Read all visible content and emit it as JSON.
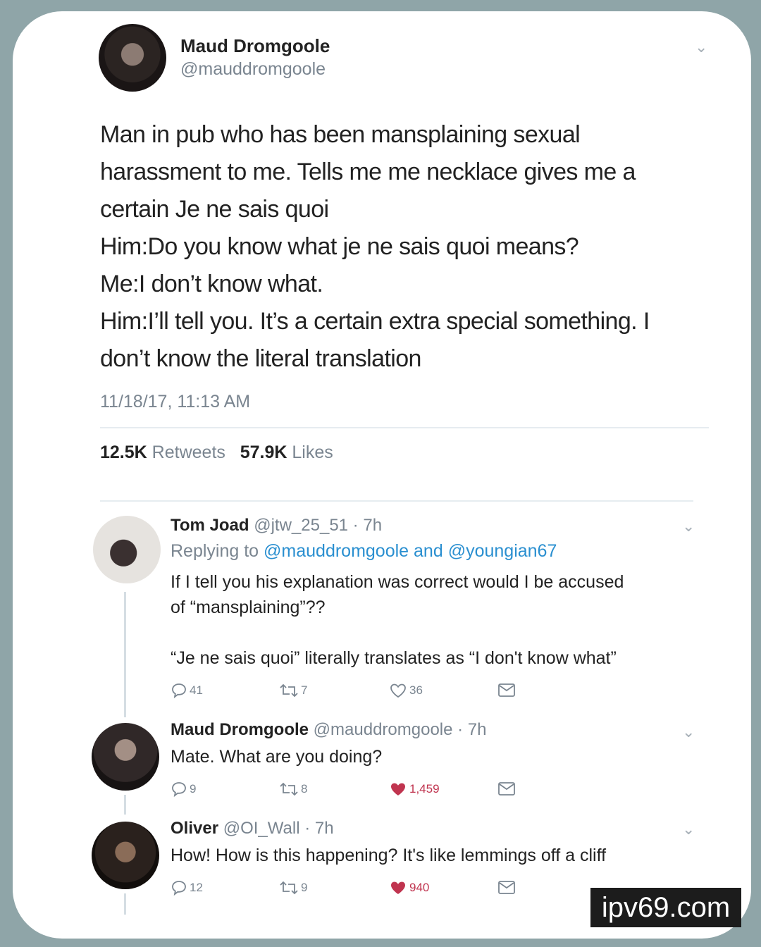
{
  "main_tweet": {
    "author_name": "Maud Dromgoole",
    "author_handle": "@mauddromgoole",
    "lines": [
      "Man in pub who has been mansplaining sexual",
      "harassment to me. Tells me me necklace gives me a",
      "certain Je ne sais quoi",
      "Him:Do you know what je ne sais quoi means?",
      "Me:I don’t know what.",
      "Him:I’ll tell you. It’s a certain extra special something. I",
      "don’t know the literal translation"
    ],
    "timestamp": "11/18/17, 11:13 AM",
    "retweets_count": "12.5K",
    "retweets_label": "Retweets",
    "likes_count": "57.9K",
    "likes_label": "Likes"
  },
  "replies": [
    {
      "name": "Tom Joad",
      "meta": "@jtw_25_51 · 7h",
      "replying_prefix": "Replying to",
      "replying_user1": "@mauddromgoole",
      "replying_and": "and",
      "replying_user2": "@youngian67",
      "lines": [
        "If I tell you his explanation was correct would I be accused",
        "of “mansplaining”??",
        "",
        "“Je ne sais quoi” literally translates as “I don't know what”"
      ],
      "replies_count": "41",
      "retweets_count": "7",
      "likes_count": "36",
      "liked": false
    },
    {
      "name": "Maud Dromgoole",
      "meta": "@mauddromgoole · 7h",
      "lines": [
        "Mate. What are you doing?"
      ],
      "replies_count": "9",
      "retweets_count": "8",
      "likes_count": "1,459",
      "liked": true
    },
    {
      "name": "Oliver",
      "meta": "@OI_Wall · 7h",
      "lines": [
        "How! How is this happening? It's like lemmings off a cliff"
      ],
      "replies_count": "12",
      "retweets_count": "9",
      "likes_count": "940",
      "liked": true
    }
  ],
  "watermark": "ipv69.com",
  "colors": {
    "background": "#8fa5a8",
    "link": "#2a8fd0",
    "like": "#c0344f",
    "muted": "#7a8590"
  },
  "icons": [
    "chevron-down-icon",
    "reply-icon",
    "retweet-icon",
    "heart-icon",
    "message-icon"
  ]
}
